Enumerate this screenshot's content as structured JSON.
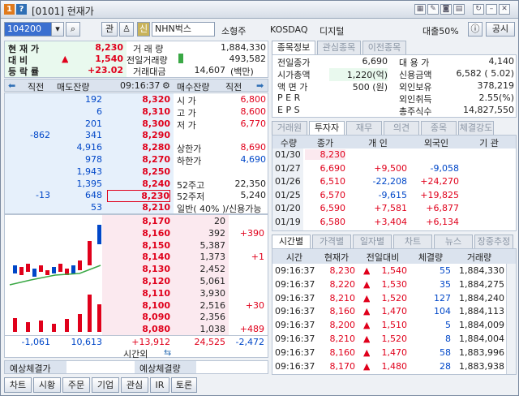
{
  "window": {
    "title": "[0101] 현재가",
    "num": "1",
    "qmark": "?"
  },
  "toolbar": {
    "code": "104200",
    "gwan": "관",
    "sin": "신",
    "name": "NHN벅스",
    "sector_a": "소형주",
    "market": "KOSDAQ",
    "sector_b": "디지털",
    "margin": "대출50%",
    "pub": "공시"
  },
  "summary": {
    "labels": [
      "현 재 가",
      "대    비",
      "등 락 률"
    ],
    "price": "8,230",
    "diff": "1,540",
    "rate": "+23.02",
    "vol_label": "거  래  량",
    "vol": "1,884,330",
    "prev_vol_label": "전일거래량",
    "prev_vol": "493,582",
    "amt_label": "거래대금",
    "amt": "14,607",
    "amt_unit": "(백만)"
  },
  "ob": {
    "h_jikjeon": "직전",
    "h_sell": "매도잔량",
    "time": "09:16:37",
    "h_buy": "매수잔량",
    "h_jikjeon2": "직전",
    "sell_rows": [
      {
        "chg": "",
        "qty": "192",
        "price": "8,320"
      },
      {
        "chg": "",
        "qty": "6",
        "price": "8,310"
      },
      {
        "chg": "",
        "qty": "201",
        "price": "8,300"
      },
      {
        "chg": "-862",
        "qty": "341",
        "price": "8,290"
      },
      {
        "chg": "",
        "qty": "4,916",
        "price": "8,280"
      },
      {
        "chg": "",
        "qty": "978",
        "price": "8,270"
      },
      {
        "chg": "",
        "qty": "1,943",
        "price": "8,250"
      },
      {
        "chg": "",
        "qty": "1,395",
        "price": "8,240"
      },
      {
        "chg": "-13",
        "qty": "648",
        "price": "8,230"
      },
      {
        "chg": "",
        "qty": "53",
        "price": "8,210"
      }
    ],
    "info": [
      {
        "k": "시  가",
        "v": "6,800",
        "c": "red"
      },
      {
        "k": "고  가",
        "v": "8,600",
        "c": "red"
      },
      {
        "k": "저  가",
        "v": "6,770",
        "c": "red"
      },
      {
        "k": "",
        "v": "",
        "c": "dk"
      },
      {
        "k": "상한가",
        "v": "8,690",
        "c": "red"
      },
      {
        "k": "하한가",
        "v": "4,690",
        "c": "blue"
      },
      {
        "k": "",
        "v": "",
        "c": "dk"
      },
      {
        "k": "52주고",
        "v": "22,350",
        "c": "dk"
      },
      {
        "k": "52주저",
        "v": "5,240",
        "c": "dk"
      },
      {
        "k": "일반( 40% )/신용가능",
        "v": "",
        "c": "dk"
      }
    ],
    "buy_rows": [
      {
        "price": "8,170",
        "qty": "20",
        "chg": ""
      },
      {
        "price": "8,160",
        "qty": "392",
        "chg": "+390"
      },
      {
        "price": "8,150",
        "qty": "5,387",
        "chg": ""
      },
      {
        "price": "8,140",
        "qty": "1,373",
        "chg": "+1"
      },
      {
        "price": "8,130",
        "qty": "2,452",
        "chg": ""
      },
      {
        "price": "8,120",
        "qty": "5,061",
        "chg": ""
      },
      {
        "price": "8,110",
        "qty": "3,930",
        "chg": ""
      },
      {
        "price": "8,100",
        "qty": "2,516",
        "chg": "+30"
      },
      {
        "price": "8,090",
        "qty": "2,356",
        "chg": ""
      },
      {
        "price": "8,080",
        "qty": "1,038",
        "chg": "+489"
      }
    ],
    "tot_sell_chg": "-1,061",
    "tot_sell": "10,613",
    "tot_diff": "+13,912",
    "tot_buy": "24,525",
    "tot_buy_chg": "-2,472",
    "after": "시간외"
  },
  "expect": {
    "price_label": "예상체결가",
    "vol_label": "예상체결량"
  },
  "right_top": {
    "tabs": [
      "종목정보",
      "관심종목",
      "이전종목"
    ],
    "left": [
      {
        "k": "전일종가",
        "v": "6,690"
      },
      {
        "k": "시가총액",
        "v": "1,220(억)"
      },
      {
        "k": "액 면 가",
        "v": "500 (원)"
      },
      {
        "k": "P E R",
        "v": ""
      },
      {
        "k": "E P S",
        "v": ""
      }
    ],
    "right": [
      {
        "k": "대 용 가",
        "v": "4,140"
      },
      {
        "k": "신용금액",
        "v": "6,582  ( 5.02)"
      },
      {
        "k": "외인보유",
        "v": "378,219"
      },
      {
        "k": "외인취득",
        "v": "2.55(%)"
      },
      {
        "k": "총주식수",
        "v": "14,827,550"
      }
    ]
  },
  "investor": {
    "tabs": [
      "거래원",
      "투자자",
      "재무",
      "의견",
      "종목",
      "체결강도"
    ],
    "headers": [
      "수량",
      "종가",
      "개 인",
      "외국인",
      "기 관"
    ],
    "rows": [
      {
        "d": "01/30",
        "p": "8,230",
        "i": "",
        "f": "",
        "g": ""
      },
      {
        "d": "01/27",
        "p": "6,690",
        "i": "+9,500",
        "f": "-9,058",
        "g": ""
      },
      {
        "d": "01/26",
        "p": "6,510",
        "i": "-22,208",
        "f": "+24,270",
        "g": ""
      },
      {
        "d": "01/25",
        "p": "6,570",
        "i": "-9,615",
        "f": "+19,825",
        "g": ""
      },
      {
        "d": "01/20",
        "p": "6,590",
        "i": "+7,581",
        "f": "+6,877",
        "g": ""
      },
      {
        "d": "01/19",
        "p": "6,580",
        "i": "+3,404",
        "f": "+6,134",
        "g": ""
      }
    ]
  },
  "ticks": {
    "tabs": [
      "시간별",
      "가격별",
      "일자별",
      "차트",
      "뉴스",
      "장중추정"
    ],
    "headers": [
      "시간",
      "현재가",
      "전일대비",
      "체결량",
      "거래량"
    ],
    "rows": [
      {
        "t": "09:16:37",
        "p": "8,230",
        "d": "1,540",
        "q": "55",
        "v": "1,884,330"
      },
      {
        "t": "09:16:37",
        "p": "8,220",
        "d": "1,530",
        "q": "35",
        "v": "1,884,275"
      },
      {
        "t": "09:16:37",
        "p": "8,210",
        "d": "1,520",
        "q": "127",
        "v": "1,884,240"
      },
      {
        "t": "09:16:37",
        "p": "8,160",
        "d": "1,470",
        "q": "104",
        "v": "1,884,113"
      },
      {
        "t": "09:16:37",
        "p": "8,200",
        "d": "1,510",
        "q": "5",
        "v": "1,884,009"
      },
      {
        "t": "09:16:37",
        "p": "8,210",
        "d": "1,520",
        "q": "8",
        "v": "1,884,004"
      },
      {
        "t": "09:16:37",
        "p": "8,160",
        "d": "1,470",
        "q": "58",
        "v": "1,883,996"
      },
      {
        "t": "09:16:37",
        "p": "8,170",
        "d": "1,480",
        "q": "28",
        "v": "1,883,938"
      }
    ]
  },
  "bottom": [
    "차트",
    "시황",
    "주문",
    "기업",
    "관심",
    "IR",
    "토론"
  ],
  "colors": {
    "up": "#e0001b",
    "down": "#0047c8",
    "sell_bg": "#e6f0fb",
    "buy_bg": "#fbe9ef",
    "accent": "#3aa845"
  }
}
